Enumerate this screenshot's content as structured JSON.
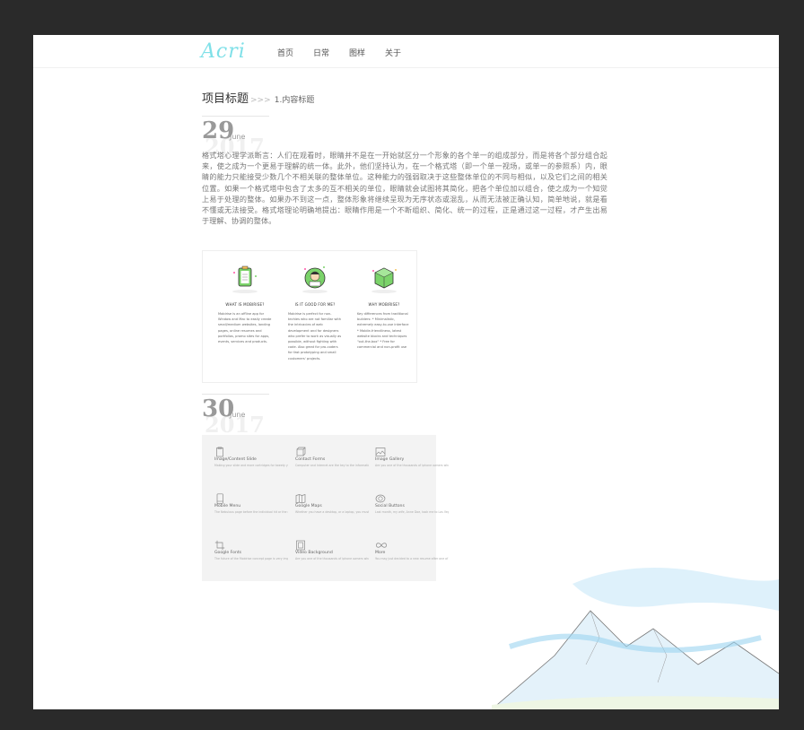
{
  "brand": {
    "logo": "Acri"
  },
  "nav": {
    "items": [
      "首页",
      "日常",
      "图样",
      "关于"
    ]
  },
  "breadcrumb": {
    "title": "项目标题",
    "sep": ">>>",
    "sub": "1.内容标题"
  },
  "post1": {
    "day": "29",
    "month": "June",
    "year": "2017",
    "body": "格式塔心理学派断言：人们在观看时，眼睛并不是在一开始就区分一个形象的各个单一的组成部分，而是将各个部分组合起来，使之成为一个更易于理解的统一体。此外，他们坚持认为，在一个格式塔（即一个单一视场，或单一的参照系）内，眼睛的能力只能接受少数几个不相关联的整体单位。这种能力的强弱取决于这些整体单位的不同与相似，以及它们之间的相关位置。如果一个格式塔中包含了太多的互不相关的单位，眼睛就会试图将其简化，把各个单位加以组合，使之成为一个知觉上易于处理的整体。如果办不到这一点，整体形象将继续呈现为无序状态或混乱，从而无法被正确认知，简单地说，就是看不懂或无法接受。格式塔理论明确地提出：眼睛作用是一个不断组织、简化、统一的过程，正是通过这一过程，才产生出易于理解、协调的整体。",
    "features": [
      {
        "title": "WHAT IS MOBIRISE?",
        "desc": "Mobirise is an offline app for Window and Mac to easily create small/medium websites, landing pages, online resumes and portfolios, promo sites for apps, events, services and products."
      },
      {
        "title": "IS IT GOOD FOR ME?",
        "desc": "Mobirise is perfect for non-techies who are not familiar with the intricacies of web development and for designers who prefer to work as visually as possible, without fighting with code. Also great for pro-coders for fast prototyping and small customers' projects."
      },
      {
        "title": "WHY MOBIRISE?",
        "desc": "Key differences from traditional builders: * Minimalistic, extremely easy-to-use interface * Mobile-friendliness, latest website blocks and techniques \"out-the-box\" * Free for commercial and non-profit use"
      }
    ]
  },
  "post2": {
    "day": "30",
    "month": "June",
    "year": "2017",
    "cells": [
      {
        "icon": "clipboard-icon",
        "title": "Image/Content Slide",
        "desc": "Making your slide and more cartridges for tweety years, there have been a lot of changes in the laser cartridge market. The"
      },
      {
        "icon": "cube-icon",
        "title": "Contact Forms",
        "desc": "Computer and Internet are the key to the information world we live in. People with time and also more on the Internet. Online games"
      },
      {
        "icon": "image-icon",
        "title": "Image Gallery",
        "desc": "Are you one of the thousands of iphone owners who has no idea that they can get free games for their iphone? It's pretty cool"
      },
      {
        "icon": "mobile-icon",
        "title": "Mobile Menu",
        "desc": "The Nebulous page before the individual hit or the characteristics, traits, personal interests and the overall personality of the"
      },
      {
        "icon": "map-icon",
        "title": "Google Maps",
        "desc": "Whether you have a desktop, or a laptop, you must have a computer accessories and peripherals to derive the maximum benefit"
      },
      {
        "icon": "circle-icon",
        "title": "Social Buttons",
        "desc": "Last month, my wife, Anne Doe, took me to Las Vegas because she had to go for a business convention. Needless to say, she"
      },
      {
        "icon": "crop-icon",
        "title": "Google Fonts",
        "desc": "The future of the Mobirise concept page is very important since it forms the base. Make use the details of the brand very carefully"
      },
      {
        "icon": "film-icon",
        "title": "Video Background",
        "desc": "Are you one of the thousands of iphone owners who had no idea that they can get free games for their iphone? It's pretty cool"
      },
      {
        "icon": "infinity-icon",
        "title": "More",
        "desc": "You may just decided to a new resume after one of your dreams, and you take it at a new career. Canada. You can get a lot of"
      }
    ]
  }
}
